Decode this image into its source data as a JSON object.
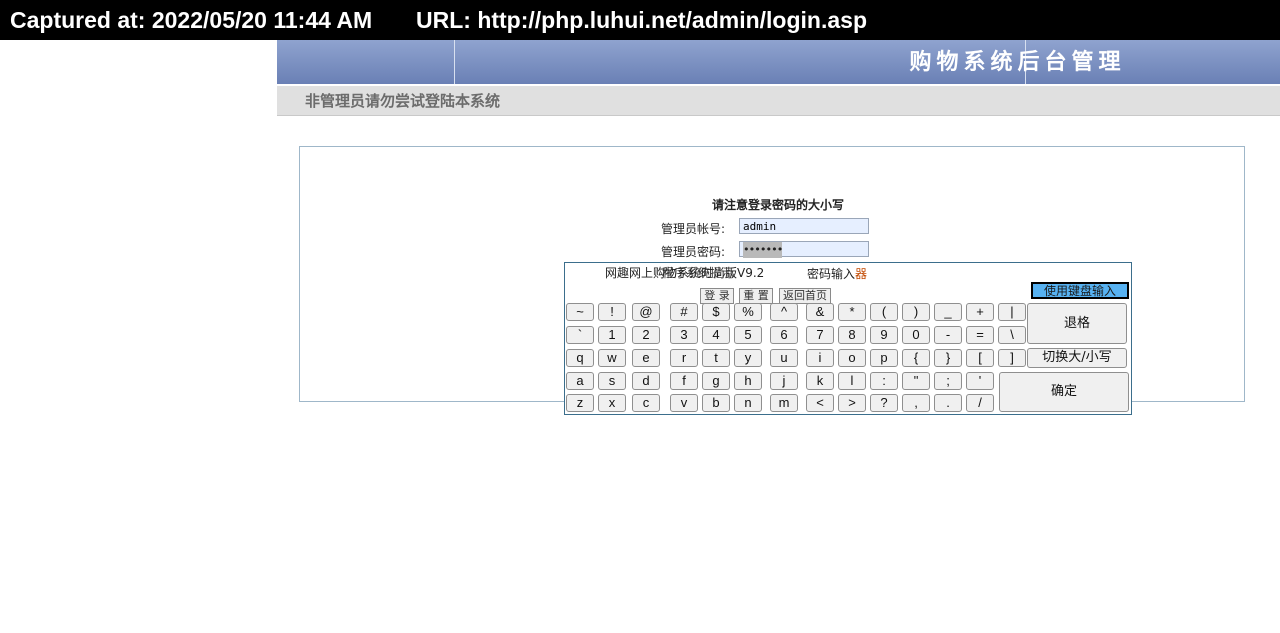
{
  "capture": {
    "captured_text": "Captured at: 2022/05/20 11:44 AM",
    "url_text": "URL: http://php.luhui.net/admin/login.asp"
  },
  "banner": {
    "title": "购物系统后台管理"
  },
  "warning": "非管理员请勿尝试登陆本系统",
  "login": {
    "notice": "请注意登录密码的大小写",
    "username_label": "管理员帐号:",
    "username_value": "admin",
    "password_label": "管理员密码:",
    "password_value": "•••••••",
    "buttons": {
      "login": "登 录",
      "reset": "重 置",
      "home": "返回首页"
    }
  },
  "keyboard": {
    "title_left": "网趣网上购物系统时尚版V9.2",
    "title_overlap": "程序系统提示",
    "title_right_prefix": "密码输入",
    "title_right_suffix": "器",
    "use_keyboard": "使用键盘输入",
    "backspace": "退格",
    "case_toggle": "切换大/小写",
    "confirm": "确定",
    "rows": [
      [
        "~",
        "!",
        "@",
        "#",
        "$",
        "%",
        "^",
        "&",
        "*",
        "(",
        ")",
        "_",
        "+",
        "|"
      ],
      [
        "`",
        "1",
        "2",
        "3",
        "4",
        "5",
        "6",
        "7",
        "8",
        "9",
        "0",
        "-",
        "=",
        "\\"
      ],
      [
        "q",
        "w",
        "e",
        "r",
        "t",
        "y",
        "u",
        "i",
        "o",
        "p",
        "{",
        "}",
        "[",
        "]"
      ],
      [
        "a",
        "s",
        "d",
        "f",
        "g",
        "h",
        "j",
        "k",
        "l",
        ":",
        "\"",
        ";",
        "'"
      ],
      [
        "z",
        "x",
        "c",
        "v",
        "b",
        "n",
        "m",
        "<",
        ">",
        "?",
        ",",
        ".",
        "/"
      ]
    ]
  }
}
